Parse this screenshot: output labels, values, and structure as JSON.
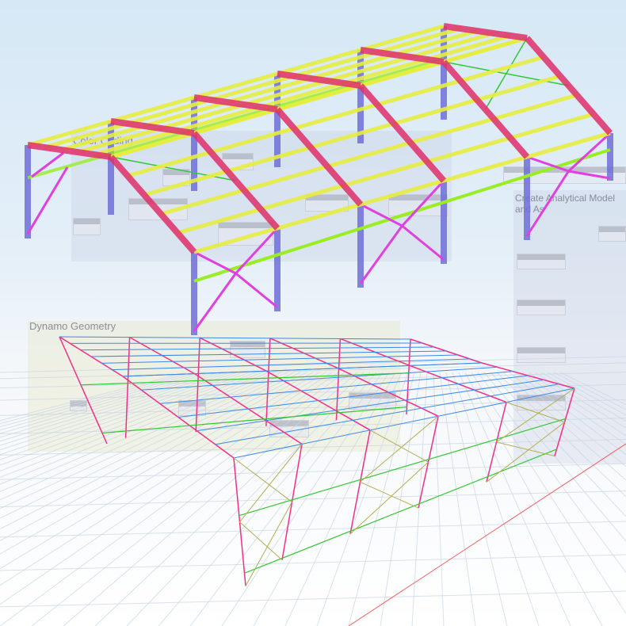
{
  "groups": {
    "color_coding": "Color Coding",
    "dynamo_geometry": "Dynamo Geometry",
    "create_analytical": "Create Analytical Model and As"
  },
  "colors": {
    "column": "#6f6fd8",
    "rafter": "#e0306a",
    "purlin": "#e6ee40",
    "bracing": "#e040e0",
    "girt": "#99ee22",
    "wire_frame": "#f0308a",
    "wire_purlin": "#3a8ae8",
    "wire_girt": "#33c833",
    "wire_brace": "#b0b050"
  }
}
